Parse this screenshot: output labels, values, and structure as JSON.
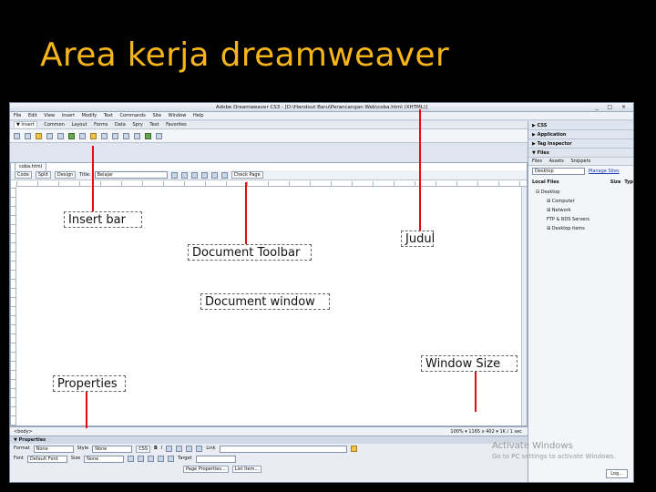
{
  "slide": {
    "title": "Area kerja dreamweaver"
  },
  "window": {
    "title": "Adobe Dreamweaver CS3 - [D:\\Handout Baru\\Perancangan Web\\coba.html (XHTML)]",
    "controls": "_ □ ×"
  },
  "menu": [
    "File",
    "Edit",
    "View",
    "Insert",
    "Modify",
    "Text",
    "Commands",
    "Site",
    "Window",
    "Help"
  ],
  "insert_tabs": [
    "▼ Insert",
    "Common",
    "Layout",
    "Forms",
    "Data",
    "Spry",
    "Text",
    "Favorites"
  ],
  "document": {
    "tab": "coba.html",
    "view_buttons": [
      "Code",
      "Split",
      "Design"
    ],
    "title_label": "Title:",
    "title_value": "Belajar",
    "check_page": "Check Page",
    "status_tag": "<body>",
    "status_right": "100%  ▾  1165 x 402 ▾  1K / 1 sec"
  },
  "properties": {
    "header": "▼ Properties",
    "format_label": "Format",
    "format_value": "None",
    "style_label": "Style",
    "style_value": "None",
    "css_button": "CSS",
    "link_label": "Link",
    "font_label": "Font",
    "font_value": "Default Font",
    "size_label": "Size",
    "size_value": "None",
    "target_label": "Target",
    "page_properties": "Page Properties...",
    "list_item": "List Item..."
  },
  "panels": {
    "css": "▶ CSS",
    "application": "▶ Application",
    "tag_inspector": "▶ Tag Inspector",
    "files": "▼ Files",
    "file_tabs": [
      "Files",
      "Assets",
      "Snippets"
    ],
    "location": "Desktop",
    "manage_sites": "Manage Sites",
    "local_files": "Local Files",
    "size_col": "Size",
    "type_col": "Typ",
    "tree": [
      "Desktop",
      "Computer",
      "Network",
      "FTP & RDS Servers",
      "Desktop items"
    ],
    "log": "Log..."
  },
  "watermark": {
    "line1": "Activate Windows",
    "line2": "Go to PC settings to activate Windows."
  },
  "callouts": {
    "insert_bar": "Insert bar",
    "document_toolbar": "Document Toolbar",
    "judul": "Judul",
    "document_window": "Document window",
    "window_size": "Window Size",
    "properties": "Properties"
  }
}
